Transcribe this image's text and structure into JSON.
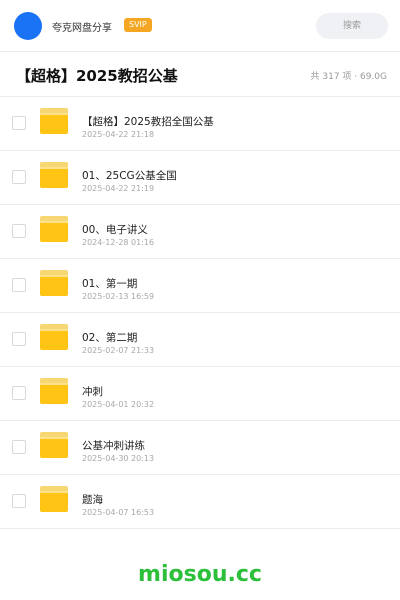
{
  "header": {
    "username": "夸克网盘分享",
    "badge": "SVIP",
    "search_placeholder": "搜索"
  },
  "title_bar": {
    "title": "【超格】2025教招公基",
    "meta": "共 317 项 · 69.0G"
  },
  "files": [
    {
      "name": "【超格】2025教招全国公基",
      "date": "2025-04-22 21:18",
      "icon": "folder-icon"
    },
    {
      "name": "01、25CG公基全国",
      "date": "2025-04-22 21:19",
      "icon": "folder-icon"
    },
    {
      "name": "00、电子讲义",
      "date": "2024-12-28 01:16",
      "icon": "folder-icon"
    },
    {
      "name": "01、第一期",
      "date": "2025-02-13 16:59",
      "icon": "folder-icon"
    },
    {
      "name": "02、第二期",
      "date": "2025-02-07 21:33",
      "icon": "folder-icon"
    },
    {
      "name": "冲刺",
      "date": "2025-04-01 20:32",
      "icon": "folder-icon"
    },
    {
      "name": "公基冲刺讲练",
      "date": "2025-04-30 20:13",
      "icon": "folder-icon"
    },
    {
      "name": "题海",
      "date": "2025-04-07 16:53",
      "icon": "folder-icon"
    }
  ],
  "footer": {
    "watermark": "miosou.cc"
  },
  "colors": {
    "avatar": "#1a73f5",
    "badge": "#f5a623",
    "folder": "#ffc414",
    "watermark": "#2bbf3a"
  }
}
